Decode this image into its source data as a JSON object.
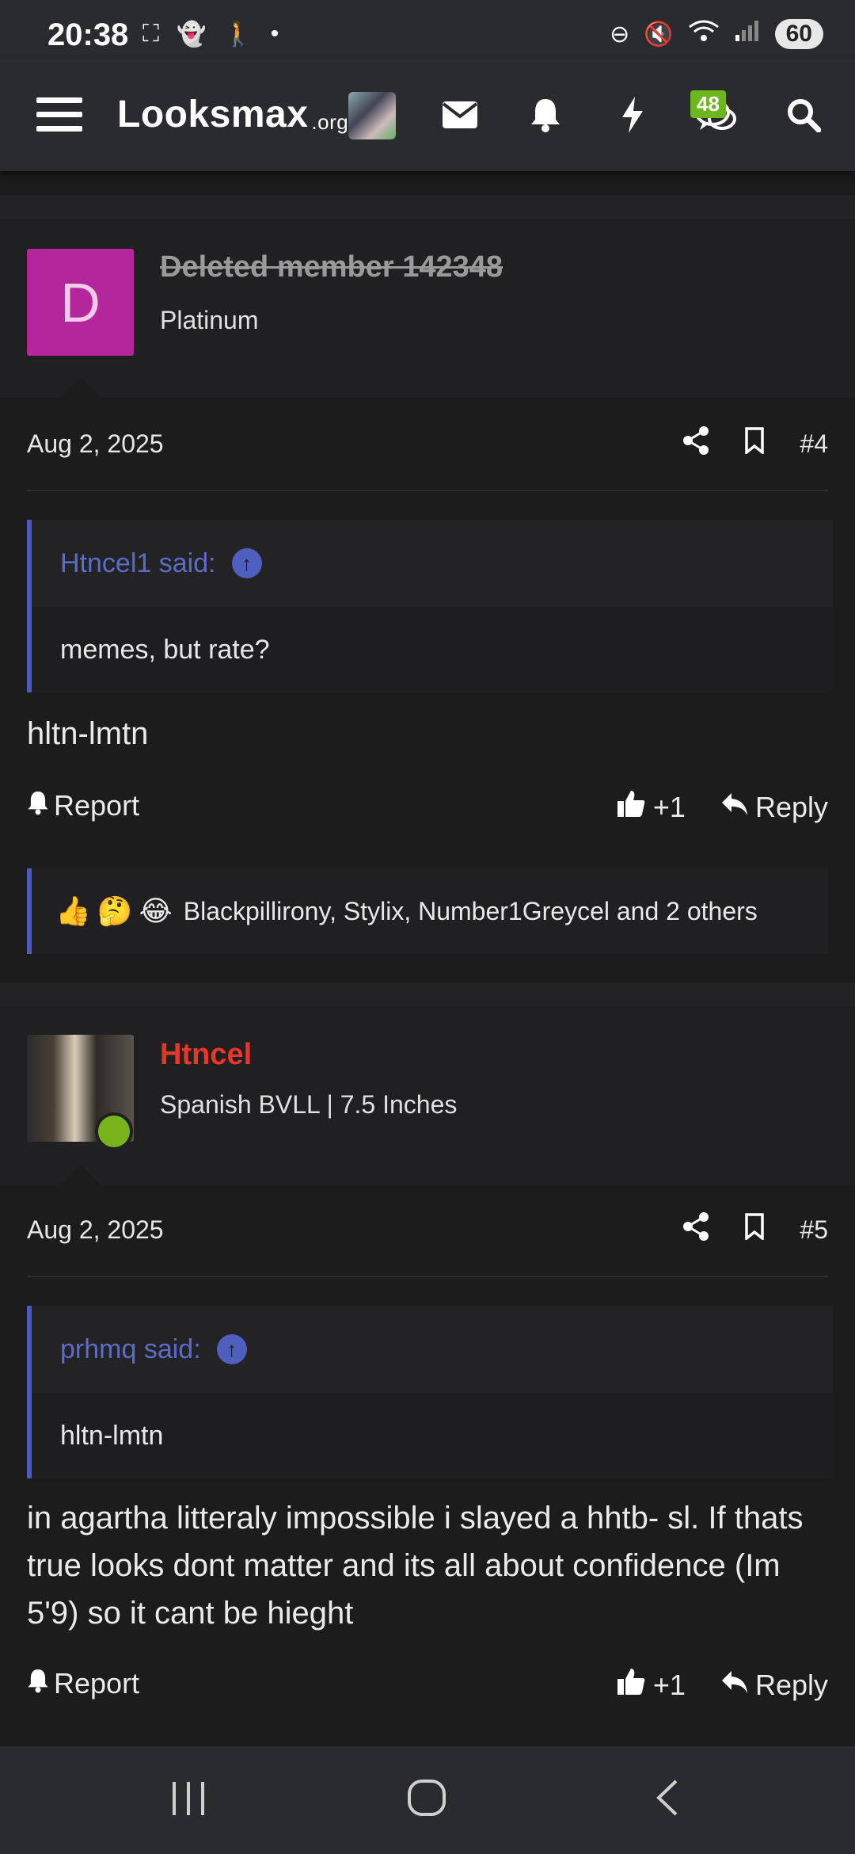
{
  "status": {
    "time": "20:38",
    "battery": "60"
  },
  "nav": {
    "logo": "Looksmax",
    "logo_suffix": ".org",
    "chat_badge": "48"
  },
  "posts": [
    {
      "avatar_letter": "D",
      "username": "Deleted member 142348",
      "usertitle": "Platinum",
      "date": "Aug 2, 2025",
      "number": "#4",
      "quote_author": "Htncel1 said:",
      "quote_text": "memes, but rate?",
      "message": "hltn-lmtn",
      "report": "Report",
      "like_count": "+1",
      "reply": "Reply",
      "reactions_text": "Blackpillirony, Stylix, Number1Greycel and 2 others"
    },
    {
      "username": "Htncel",
      "usertitle": "Spanish BVLL | 7.5 Inches",
      "date": "Aug 2, 2025",
      "number": "#5",
      "quote_author": "prhmq said:",
      "quote_text": "hltn-lmtn",
      "message": "in agartha litteraly impossible i slayed a hhtb- sl. If thats true looks dont matter and its all about confidence (Im 5'9) so it cant be hieght",
      "report": "Report",
      "like_count": "+1",
      "reply": "Reply"
    }
  ],
  "icons": {
    "menu": "hamburger-icon",
    "mail": "envelope-icon",
    "alerts": "bell-icon",
    "whatsnew": "lightning-icon",
    "chat": "chat-icon",
    "search": "search-icon"
  },
  "colors": {
    "accent": "#4f5bb8",
    "badge_green": "#6eb61f",
    "username_red": "#e8362b",
    "avatar_magenta": "#b4269c"
  }
}
